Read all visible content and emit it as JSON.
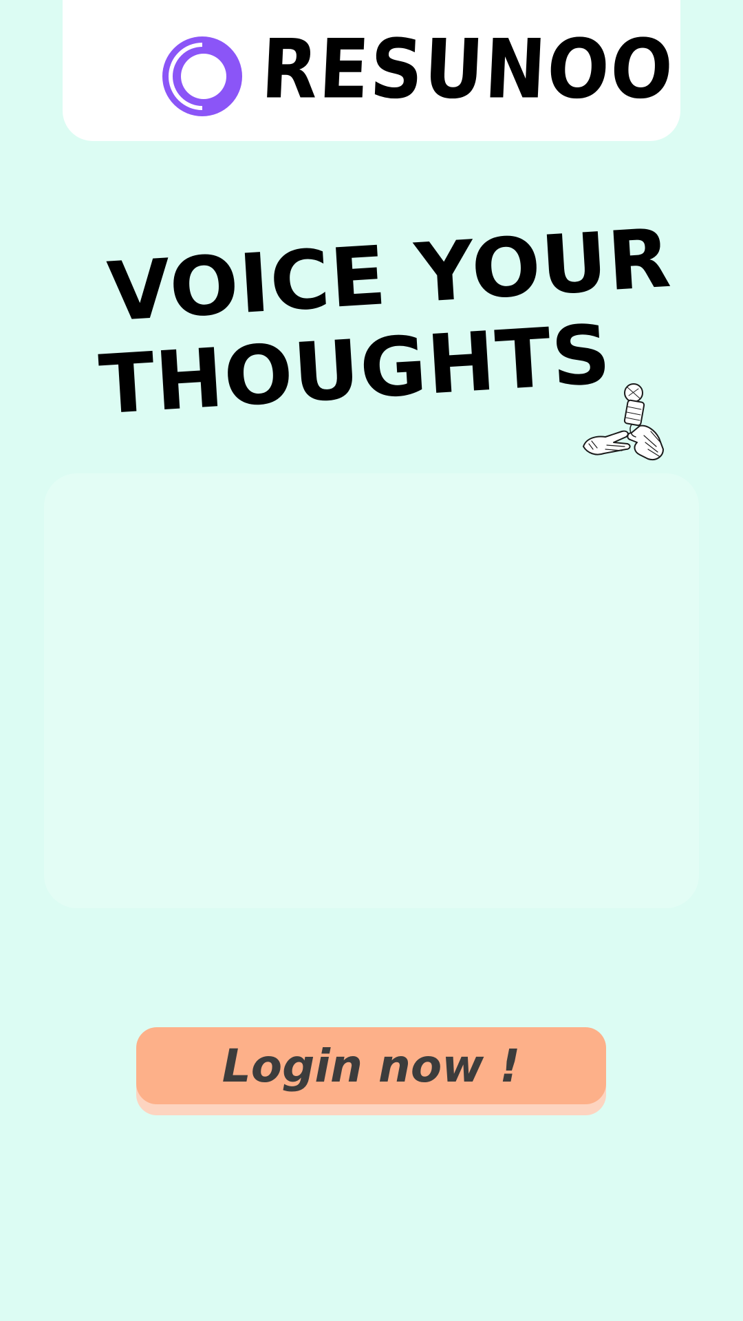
{
  "header": {
    "brand_name": "RESUNOO",
    "logo_icon": "resunoo-logo-icon",
    "logo_color": "#8b55f7"
  },
  "hero": {
    "line1": "VOICE YOUR",
    "line2": "THOUGHTS",
    "illustration_icon": "hands-holding-microphone-icon"
  },
  "login": {
    "label": "Login now !",
    "color": "#fdb089"
  },
  "colors": {
    "background": "#dcfcf3",
    "panel": "#e3fdf5",
    "header": "#ffffff"
  }
}
